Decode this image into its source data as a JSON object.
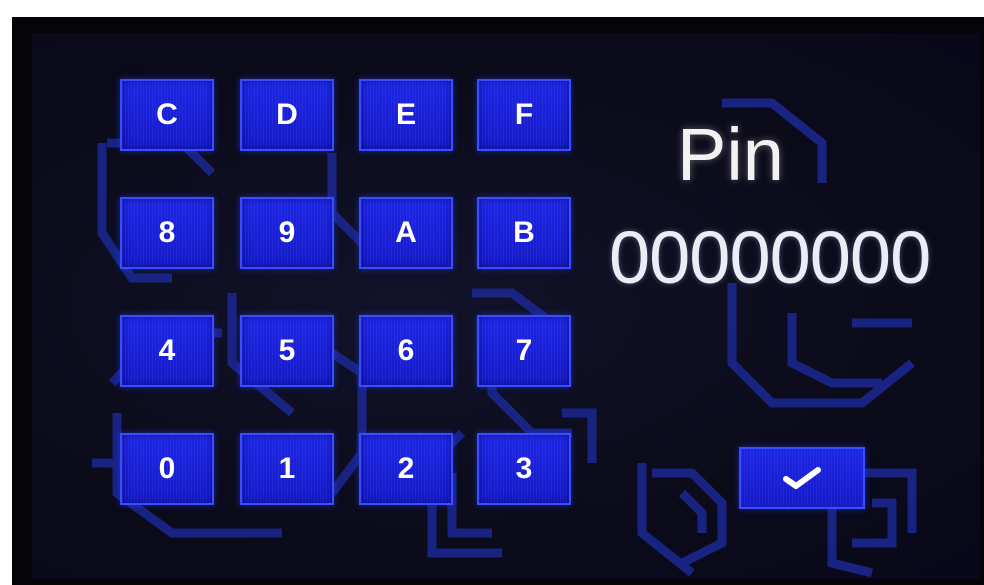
{
  "keypad": {
    "keys": [
      "C",
      "D",
      "E",
      "F",
      "8",
      "9",
      "A",
      "B",
      "4",
      "5",
      "6",
      "7",
      "0",
      "1",
      "2",
      "3"
    ]
  },
  "pin": {
    "label": "Pin",
    "value": "00000000"
  },
  "confirm": {
    "icon": "checkmark-icon"
  },
  "colors": {
    "button_blue": "#1d26e6",
    "trace_blue": "#1e2a9e",
    "background": "#0b0b1a",
    "text": "#ffffff"
  }
}
